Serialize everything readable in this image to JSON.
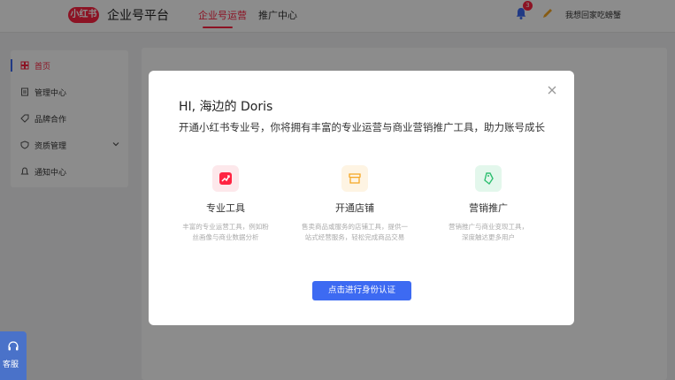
{
  "header": {
    "logo_text": "小红书",
    "platform_title": "企业号平台",
    "tabs": [
      {
        "label": "企业号运营",
        "active": true
      },
      {
        "label": "推广中心",
        "active": false
      }
    ],
    "notification_count": "3",
    "username": "我想回家吃螃蟹"
  },
  "sidebar": {
    "items": [
      {
        "label": "首页",
        "icon": "home-icon",
        "active": true
      },
      {
        "label": "管理中心",
        "icon": "document-icon",
        "active": false
      },
      {
        "label": "品牌合作",
        "icon": "tag-icon",
        "active": false
      },
      {
        "label": "资质管理",
        "icon": "shield-icon",
        "active": false,
        "expandable": true
      },
      {
        "label": "通知中心",
        "icon": "bell-icon",
        "active": false
      }
    ]
  },
  "service": {
    "label": "客服",
    "icon": "headset-icon"
  },
  "modal": {
    "title": "HI, 海边的 Doris",
    "subtitle": "开通小红书专业号，你将拥有丰富的专业运营与商业营销推广工具，助力账号成长",
    "features": [
      {
        "title": "专业工具",
        "desc_line1": "丰富的专业运营工具，例如粉",
        "desc_line2": "丝画像与商业数据分析",
        "icon": "chart-icon",
        "color": "#ff2442",
        "bg": "#fde8eb"
      },
      {
        "title": "开通店铺",
        "desc_line1": "售卖商品或服务的店铺工具，提供一",
        "desc_line2": "站式经营服务，轻松完成商品交易",
        "icon": "shop-icon",
        "color": "#f5a623",
        "bg": "#fef4e3"
      },
      {
        "title": "营销推广",
        "desc_line1": "营销推广与商业变现工具，",
        "desc_line2": "深度触达更多用户",
        "icon": "price-tag-icon",
        "color": "#2fbf71",
        "bg": "#e3f7ec"
      }
    ],
    "cta_label": "点击进行身份认证"
  },
  "colors": {
    "brand_red": "#ff2442",
    "primary_blue": "#3d6af2"
  }
}
